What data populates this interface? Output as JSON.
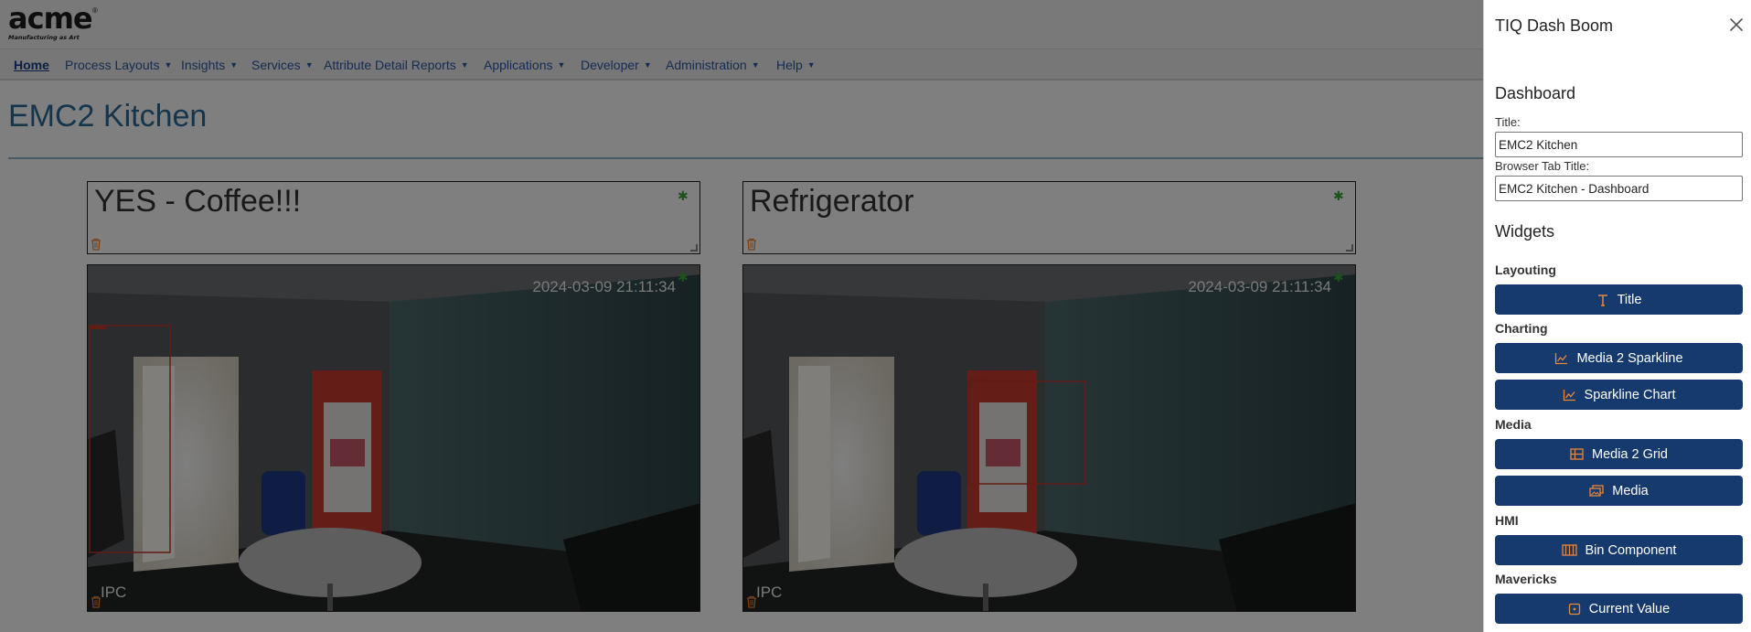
{
  "app": {
    "logo_text": "acme",
    "logo_tagline": "Manufacturing as Art",
    "logo_reg": "®"
  },
  "nav": {
    "home": "Home",
    "items": [
      "Process Layouts",
      "Insights",
      "Services",
      "Attribute Detail Reports",
      "Applications",
      "Developer",
      "Administration",
      "Help"
    ]
  },
  "dashboard": {
    "title": "EMC2 Kitchen",
    "widgets": {
      "title_left": "YES - Coffee!!!",
      "title_right": "Refrigerator",
      "media_left": {
        "timestamp": "2024-03-09 21:11:34",
        "camera": "IPC"
      },
      "media_right": {
        "timestamp": "2024-03-09 21:11:34",
        "camera": "IPC"
      }
    }
  },
  "panel": {
    "title": "TIQ Dash Boom",
    "dashboard_heading": "Dashboard",
    "title_label": "Title:",
    "title_value": "EMC2 Kitchen",
    "tab_title_label": "Browser Tab Title:",
    "tab_title_value": "EMC2 Kitchen - Dashboard",
    "widgets_heading": "Widgets",
    "groups": {
      "layouting": "Layouting",
      "charting": "Charting",
      "media": "Media",
      "hmi": "HMI",
      "mavericks": "Mavericks"
    },
    "buttons": {
      "title": "Title",
      "media2sparkline": "Media 2 Sparkline",
      "sparkline": "Sparkline Chart",
      "media2grid": "Media 2 Grid",
      "media": "Media",
      "bin": "Bin Component",
      "current_value": "Current Value"
    }
  },
  "colors": {
    "accent": "#163a6e",
    "icon_orange": "#e8883a",
    "gear_green": "#3aa43a",
    "title_blue": "#2b6b98"
  }
}
